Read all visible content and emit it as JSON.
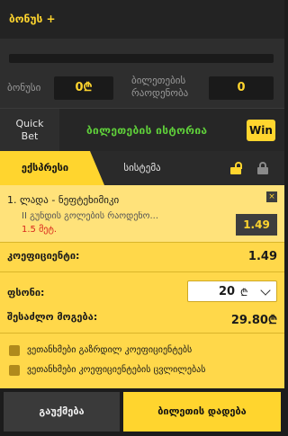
{
  "bonus": {
    "title": "ბონუს +",
    "bonus_label": "ბონუსი",
    "bonus_value": "0₾",
    "tickets_label_1": "ბილეთების",
    "tickets_label_2": "რაოდენობა",
    "tickets_value": "0"
  },
  "tabs": {
    "quick_bet_1": "Quick",
    "quick_bet_2": "Bet",
    "history": "ბილეთების ისტორია",
    "win": "Win"
  },
  "mode": {
    "express": "ექსპრესი",
    "system": "სისტემა"
  },
  "selection": {
    "index_match": "1. ლადა - ნეფტეხიმიკი",
    "market": "II გუნდის გოლების რაოდენო...",
    "outcome": "1.5 მეტ.",
    "odds": "1.49",
    "close": "×"
  },
  "slip": {
    "coef_label": "კოეფიციენტი:",
    "coef_value": "1.49",
    "stake_label": "ფსონი:",
    "stake_value": "20",
    "currency": "₾",
    "payout_label": "შესაძლო მოგება:",
    "payout_value": "29.80₾",
    "opt1": "ვეთანხმები გაზრდილ კოეფიციენტებს",
    "opt2": "ვეთანხმები კოეფიციენტების ცვლილებას"
  },
  "actions": {
    "cancel": "გაუქმება",
    "place": "ბილეთის დადება"
  }
}
